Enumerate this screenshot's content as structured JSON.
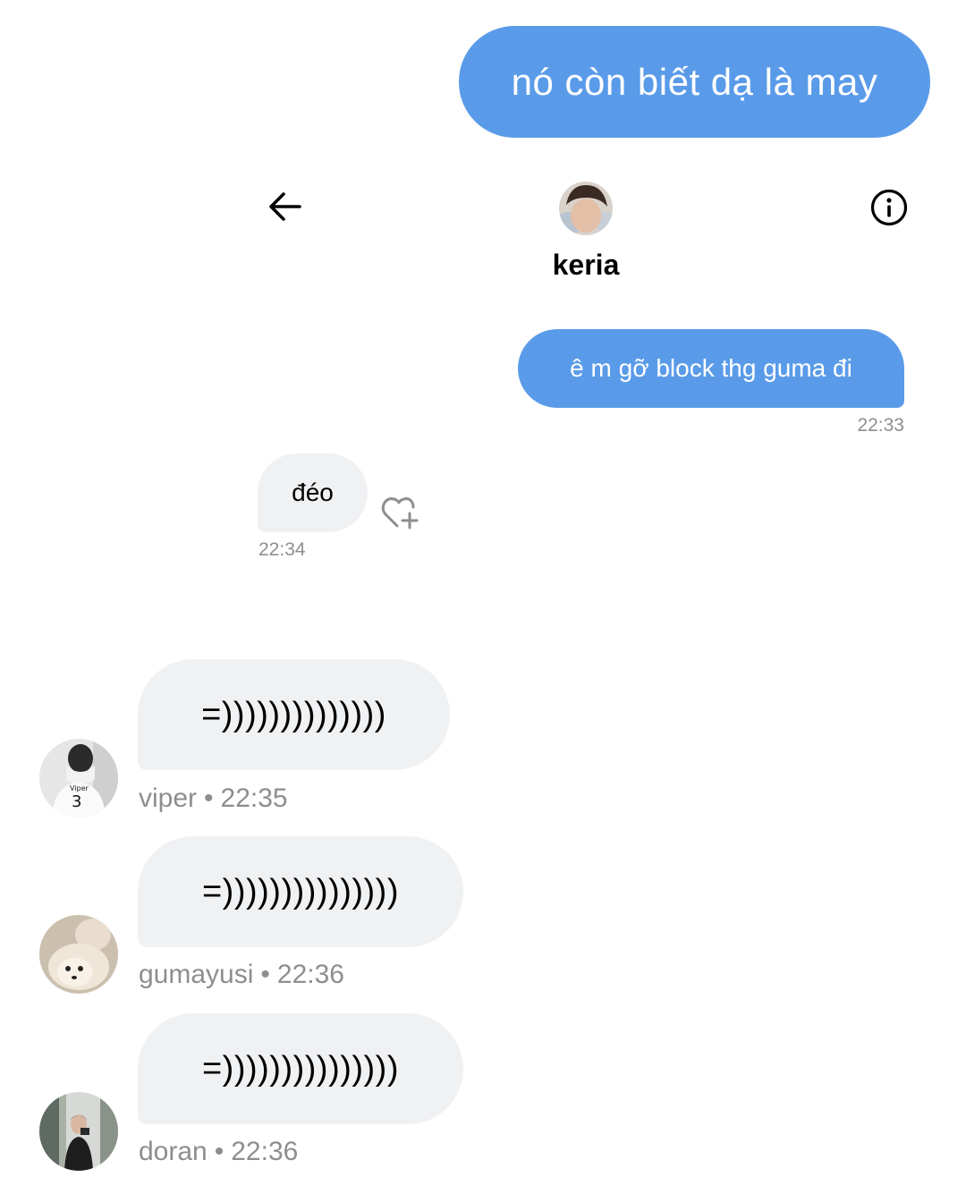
{
  "top_bubble": {
    "text": "nó còn biết dạ là may"
  },
  "chat_header": {
    "name": "keria",
    "back_icon": "arrow-left-icon",
    "info_icon": "info-circle-icon"
  },
  "outgoing": {
    "text": "ê m gỡ block thg guma đi",
    "time": "22:33"
  },
  "incoming": {
    "text": "đéo",
    "time": "22:34",
    "reaction_icon": "heart-plus-icon"
  },
  "group_messages": [
    {
      "text": "=))))))))))))))",
      "sender": "viper",
      "separator": "•",
      "time": "22:35"
    },
    {
      "text": "=)))))))))))))))",
      "sender": "gumayusi",
      "separator": "•",
      "time": "22:36"
    },
    {
      "text": "=)))))))))))))))",
      "sender": "doran",
      "separator": "•",
      "time": "22:36"
    }
  ],
  "colors": {
    "outgoing_bubble": "#5a9be9",
    "incoming_bubble": "#f0f1f3",
    "meta_text": "#8e8e8e"
  }
}
